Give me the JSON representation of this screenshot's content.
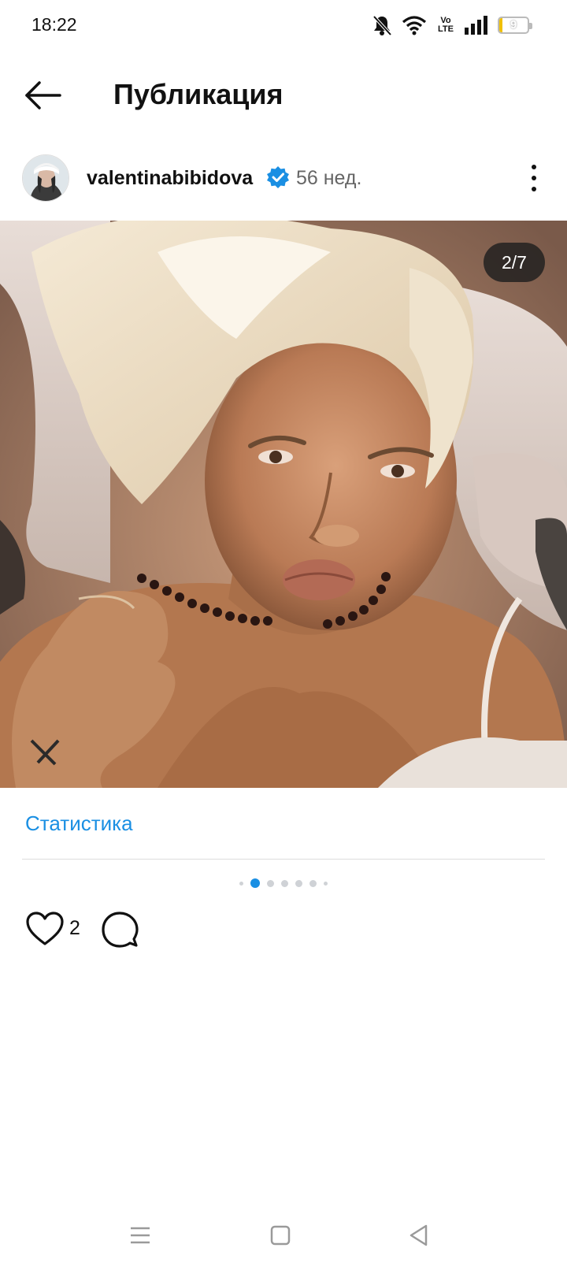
{
  "status_bar": {
    "time": "18:22",
    "network_label_top": "Vo",
    "network_label_bottom": "LTE",
    "battery_level": "9",
    "battery_percent": 9,
    "battery_color": "#f0c000"
  },
  "header": {
    "title": "Публикация",
    "back_icon": "arrow-left-icon"
  },
  "post": {
    "username": "valentinabibidova",
    "verified": true,
    "verified_color": "#1a8fe3",
    "age": "56 нед.",
    "counter": "2/7",
    "stats_label": "Статистика",
    "likes": "2",
    "carousel": {
      "total": 7,
      "active_index": 1
    }
  },
  "colors": {
    "accent": "#1a8fe3",
    "text": "#111111",
    "muted": "#666666"
  }
}
